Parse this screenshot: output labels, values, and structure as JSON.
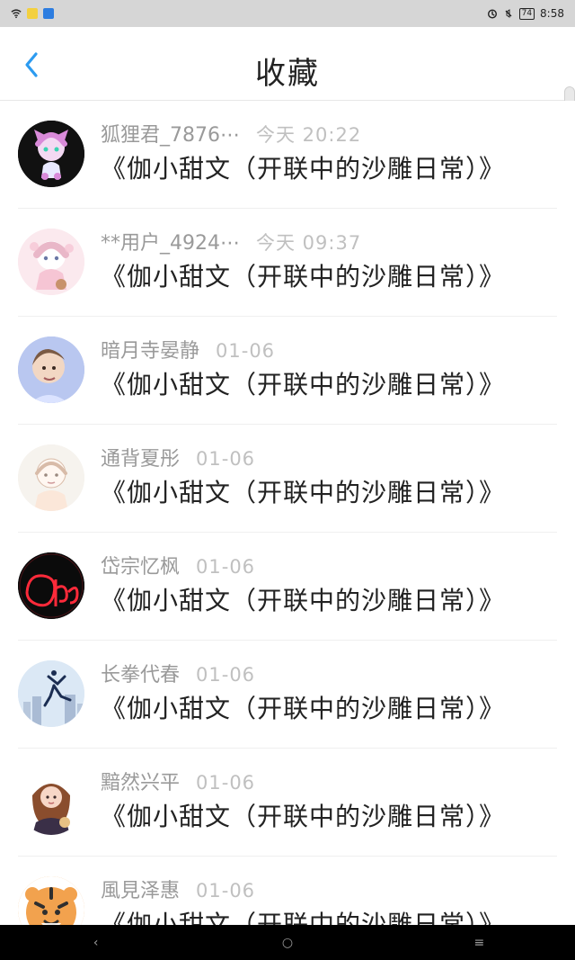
{
  "status_bar": {
    "time": "8:58",
    "battery": "74",
    "icons": [
      "wifi-icon",
      "sim-icon",
      "notification-app-icon",
      "alarm-icon",
      "mute-icon"
    ]
  },
  "header": {
    "back_icon": "chevron-left-icon",
    "title": "收藏",
    "accent_color": "#2c9bf0"
  },
  "items": [
    {
      "username": "狐狸君_7876⋯",
      "time": "今天 20:22",
      "title": "《伽小甜文（开联中的沙雕日常）》",
      "avatar_icon": "anime-cat-girl-avatar",
      "avatar_color": "#111111",
      "accent": "#d98ad9"
    },
    {
      "username": "**用户_4924⋯",
      "time": "今天 09:37",
      "title": "《伽小甜文（开联中的沙雕日常）》",
      "avatar_icon": "anime-girl-pastel-avatar",
      "avatar_color": "#fbe9ee",
      "accent": "#e9b7c8"
    },
    {
      "username": "暗月寺晏静",
      "time": "01-06",
      "title": "《伽小甜文（开联中的沙雕日常）》",
      "avatar_icon": "boy-portrait-avatar",
      "avatar_color": "#b9c7f0",
      "accent": "#7a5a44"
    },
    {
      "username": "通背夏彤",
      "time": "01-06",
      "title": "《伽小甜文（开联中的沙雕日常）》",
      "avatar_icon": "sketch-girl-avatar",
      "avatar_color": "#f6f3ee",
      "accent": "#d8bba8"
    },
    {
      "username": "岱宗忆枫",
      "time": "01-06",
      "title": "《伽小甜文（开联中的沙雕日常）》",
      "avatar_icon": "neon-open-sign-avatar",
      "avatar_color": "#0b0b0b",
      "accent": "#ff2a3a"
    },
    {
      "username": "长拳代春",
      "time": "01-06",
      "title": "《伽小甜文（开联中的沙雕日常）》",
      "avatar_icon": "jumping-person-city-avatar",
      "avatar_color": "#dbe8f5",
      "accent": "#1b2d52"
    },
    {
      "username": "黯然兴平",
      "time": "01-06",
      "title": "《伽小甜文（开联中的沙雕日常）》",
      "avatar_icon": "cartoon-girl-brown-hair-avatar",
      "avatar_color": "#ffffff",
      "accent": "#8a4d2d"
    },
    {
      "username": "風見泽惠",
      "time": "01-06",
      "title": "《伽小甜文（开联中的沙雕日常）》",
      "avatar_icon": "tiger-avatar",
      "avatar_color": "#f2a24e",
      "accent": "#2f2f2f"
    }
  ],
  "nav_bar": {
    "back_glyph": "‹",
    "home_glyph": "○",
    "recents_glyph": "≡"
  }
}
